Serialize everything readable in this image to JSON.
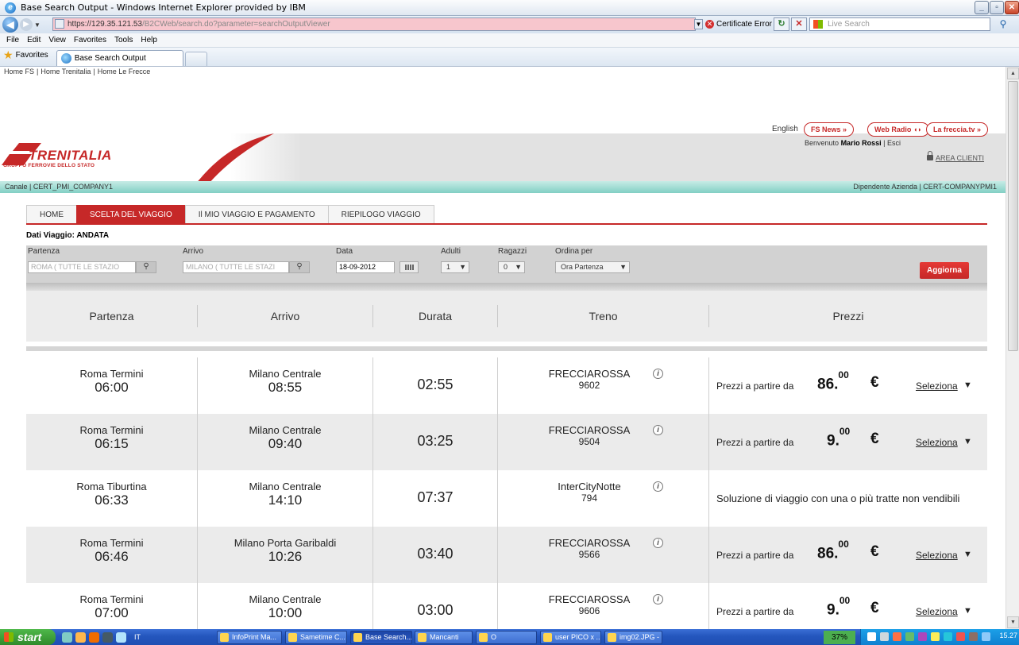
{
  "window": {
    "title": "Base Search Output - Windows Internet Explorer provided by IBM",
    "url_host": "https://129.35.121.53",
    "url_path": "/B2CWeb/search.do?parameter=searchOutputViewer",
    "cert_error": "Certificate Error",
    "search_placeholder": "Live Search"
  },
  "menu": [
    "File",
    "Edit",
    "View",
    "Favorites",
    "Tools",
    "Help"
  ],
  "favorites_label": "Favorites",
  "tab_title": "Base Search Output",
  "site": {
    "top_links": [
      "Home FS",
      "Home Trenitalia",
      "Home Le Frecce"
    ],
    "language": "English",
    "pills": [
      "FS News  »",
      "Web Radio",
      "La freccia.tv »"
    ],
    "welcome_prefix": "Benvenuto",
    "user_name": "Mario Rossi",
    "logout": "Esci",
    "logo_text": "TRENITALIA",
    "logo_sub": "GRUPPO FERROVIE DELLO STATO",
    "area_clienti": "AREA CLIENTI",
    "channel": "Canale | CERT_PMI_COMPANY1",
    "employee": "Dipendente Azienda | CERT-COMPANYPMI1",
    "brand_color": "#c62828"
  },
  "steps": [
    "HOME",
    "SCELTA DEL VIAGGIO",
    "Il MIO VIAGGIO E PAGAMENTO",
    "RIEPILOGO VIAGGIO"
  ],
  "dati_viaggio": "Dati Viaggio: ANDATA",
  "search": {
    "partenza_label": "Partenza",
    "partenza_value": "ROMA ( TUTTE LE STAZIO",
    "arrivo_label": "Arrivo",
    "arrivo_value": "MILANO ( TUTTE LE STAZI",
    "data_label": "Data",
    "data_value": "18-09-2012",
    "adulti_label": "Adulti",
    "adulti_value": "1",
    "ragazzi_label": "Ragazzi",
    "ragazzi_value": "0",
    "ordina_label": "Ordina per",
    "ordina_value": "Ora Partenza",
    "aggiorna": "Aggiorna"
  },
  "table": {
    "headers": [
      "Partenza",
      "Arrivo",
      "Durata",
      "Treno",
      "Prezzi"
    ],
    "price_prefix": "Prezzi a partire da",
    "select_label": "Seleziona",
    "rows": [
      {
        "dep_station": "Roma Termini",
        "dep_time": "06:00",
        "arr_station": "Milano Centrale",
        "arr_time": "08:55",
        "duration": "02:55",
        "train": "FRECCIAROSSA",
        "train_no": "9602",
        "price_int": "86.",
        "price_dec": "00",
        "currency": "€",
        "note": ""
      },
      {
        "dep_station": "Roma Termini",
        "dep_time": "06:15",
        "arr_station": "Milano Centrale",
        "arr_time": "09:40",
        "duration": "03:25",
        "train": "FRECCIAROSSA",
        "train_no": "9504",
        "price_int": "9.",
        "price_dec": "00",
        "currency": "€",
        "note": ""
      },
      {
        "dep_station": "Roma Tiburtina",
        "dep_time": "06:33",
        "arr_station": "Milano Centrale",
        "arr_time": "14:10",
        "duration": "07:37",
        "train": "InterCityNotte",
        "train_no": "794",
        "price_int": "",
        "price_dec": "",
        "currency": "",
        "note": "Soluzione di viaggio con una o più tratte non vendibili"
      },
      {
        "dep_station": "Roma Termini",
        "dep_time": "06:46",
        "arr_station": "Milano Porta Garibaldi",
        "arr_time": "10:26",
        "duration": "03:40",
        "train": "FRECCIAROSSA",
        "train_no": "9566",
        "price_int": "86.",
        "price_dec": "00",
        "currency": "€",
        "note": ""
      },
      {
        "dep_station": "Roma Termini",
        "dep_time": "07:00",
        "arr_station": "Milano Centrale",
        "arr_time": "10:00",
        "duration": "03:00",
        "train": "FRECCIAROSSA",
        "train_no": "9606",
        "price_int": "9.",
        "price_dec": "00",
        "currency": "€",
        "note": ""
      }
    ]
  },
  "taskbar": {
    "start": "start",
    "lang": "IT",
    "buttons": [
      "InfoPrint Ma...",
      "Sametime C...",
      "Base Search...",
      "Mancanti",
      "O",
      "user PICO x ...",
      "img02.JPG - ..."
    ],
    "battery": "37%",
    "clock": "15.27"
  }
}
